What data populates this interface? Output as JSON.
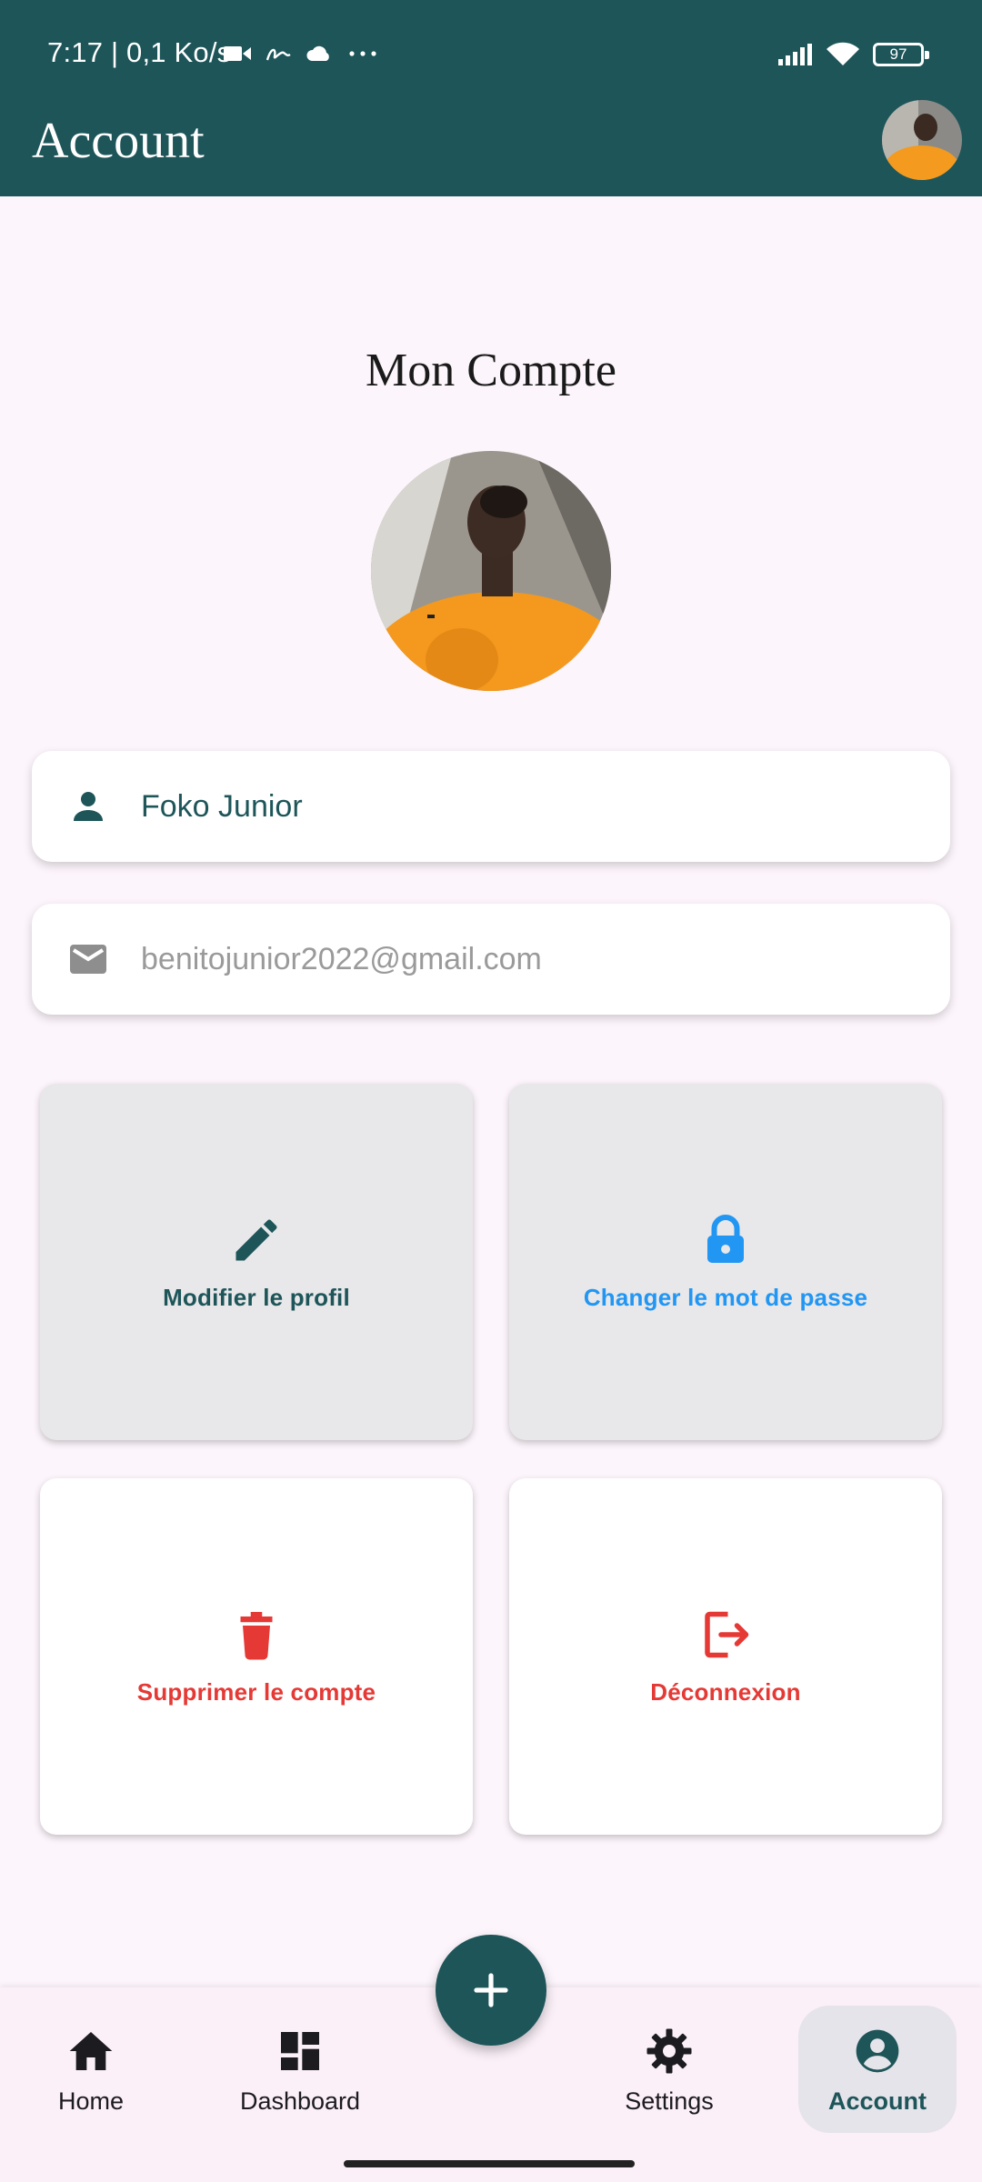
{
  "status_bar": {
    "time_and_speed": "7:17 | 0,1 Ko/s",
    "battery": "97"
  },
  "app_bar": {
    "title": "Account"
  },
  "profile": {
    "section_title": "Mon Compte",
    "name": "Foko Junior",
    "email": "benitojunior2022@gmail.com"
  },
  "actions": {
    "edit_profile": "Modifier le profil",
    "change_password": "Changer le mot de passe",
    "delete_account": "Supprimer le compte",
    "logout": "Déconnexion"
  },
  "bottom_nav": {
    "items": [
      {
        "label": "Home",
        "icon": "home-icon"
      },
      {
        "label": "Dashboard",
        "icon": "dashboard-icon"
      },
      {
        "label": "Settings",
        "icon": "gear-icon"
      },
      {
        "label": "Account",
        "icon": "account-icon",
        "selected": true
      }
    ],
    "fab_icon": "plus-icon"
  },
  "colors": {
    "primary": "#1d5559",
    "blue": "#2196f3",
    "danger": "#e53935",
    "background": "#fcf5fb"
  }
}
